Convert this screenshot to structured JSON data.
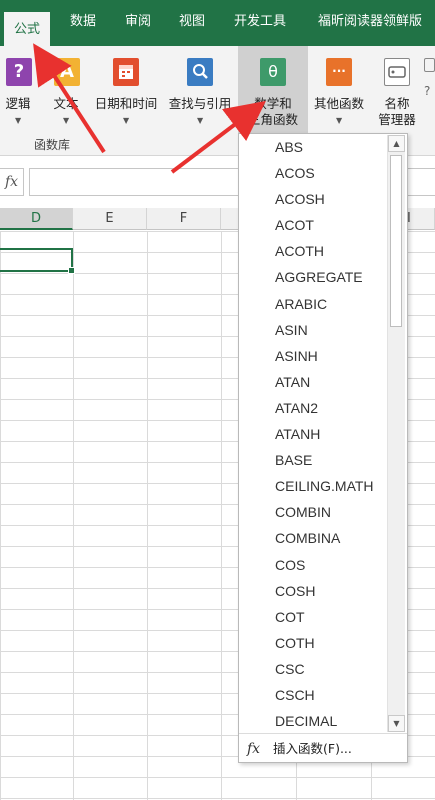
{
  "tabs": {
    "formulas": "公式",
    "data": "数据",
    "review": "审阅",
    "view": "视图",
    "developer": "开发工具",
    "foxit": "福昕阅读器领鲜版"
  },
  "ribbon": {
    "logical": {
      "label": "逻辑",
      "glyph": "?"
    },
    "text": {
      "label": "文本",
      "glyph": "A"
    },
    "datetime": {
      "label": "日期和时间"
    },
    "lookup": {
      "label": "查找与引用"
    },
    "math_trig": {
      "label_line1": "数学和",
      "label_line2": "三角函数",
      "glyph": "θ"
    },
    "other": {
      "label": "其他函数",
      "glyph": "···"
    },
    "name_manager": {
      "label_line1": "名称",
      "label_line2": "管理器"
    },
    "group_label": "函数库"
  },
  "formula_bar": {
    "fx": "fx",
    "value": ""
  },
  "columns": [
    "D",
    "E",
    "F",
    "I"
  ],
  "function_menu": {
    "items": [
      "ABS",
      "ACOS",
      "ACOSH",
      "ACOT",
      "ACOTH",
      "AGGREGATE",
      "ARABIC",
      "ASIN",
      "ASINH",
      "ATAN",
      "ATAN2",
      "ATANH",
      "BASE",
      "CEILING.MATH",
      "COMBIN",
      "COMBINA",
      "COS",
      "COSH",
      "COT",
      "COTH",
      "CSC",
      "CSCH",
      "DECIMAL"
    ],
    "insert_function": "插入函数(F)...",
    "fx": "fx"
  },
  "colors": {
    "excel_green": "#217346",
    "arrow_red": "#e8312f",
    "logical_icon": "#8e44ad",
    "text_icon": "#f2b233",
    "datetime_icon": "#e24e2e",
    "lookup_icon": "#3a7cc2",
    "math_icon": "#3e9a6a",
    "other_icon": "#e8722a"
  }
}
